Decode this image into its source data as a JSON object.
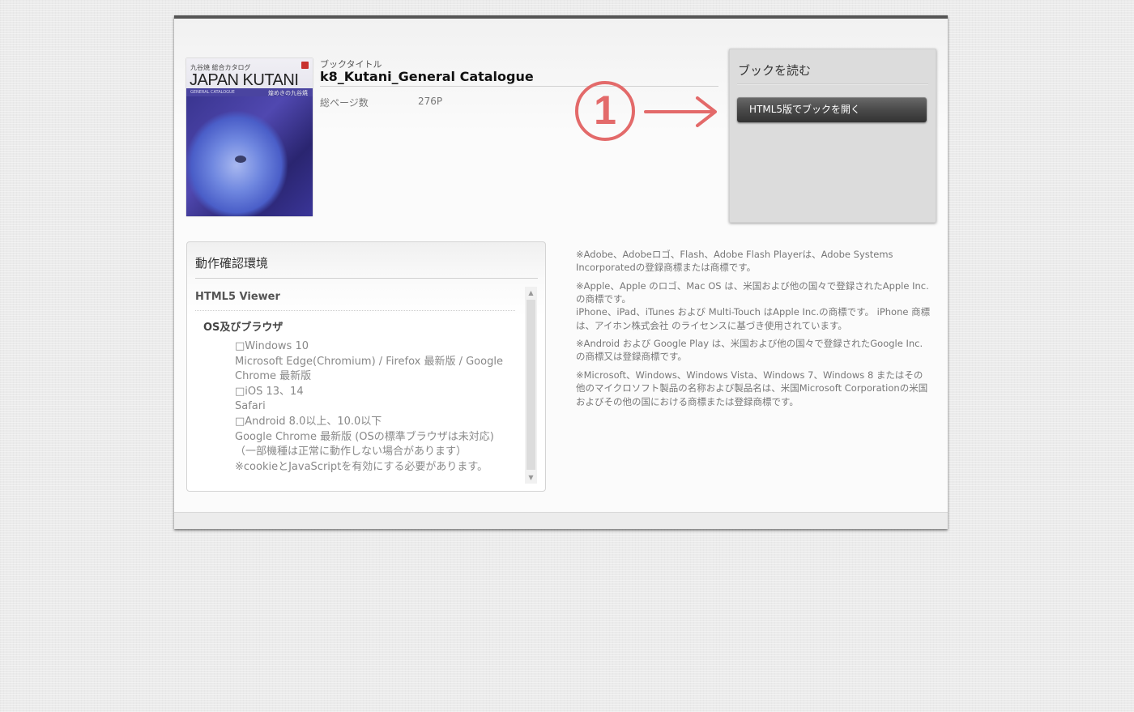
{
  "book": {
    "cover": {
      "subtitle": "九谷焼 総合カタログ",
      "title": "JAPAN KUTANI",
      "strip_en": "GENERAL CATALOGUE",
      "strip_jp": "煌めきの九谷焼"
    },
    "title_label": "ブックタイトル",
    "title": "k8_Kutani_General Catalogue",
    "pages_label": "総ページ数",
    "pages_value": "276P"
  },
  "annotation": {
    "number": "1",
    "color": "#e36a6a"
  },
  "read_box": {
    "title": "ブックを読む",
    "open_button": "HTML5版でブックを開く"
  },
  "environment": {
    "title": "動作確認環境",
    "viewer_heading": "HTML5 Viewer",
    "os_heading": "OS及びブラウザ",
    "lines": [
      "□Windows 10",
      "Microsoft Edge(Chromium) / Firefox 最新版 / Google",
      "Chrome 最新版",
      "□iOS 13、14",
      "Safari",
      "□Android 8.0以上、10.0以下",
      "Google Chrome 最新版 (OSの標準ブラウザは未対応)",
      "（一部機種は正常に動作しない場合があります）",
      "※cookieとJavaScriptを有効にする必要があります。"
    ],
    "scroll_up": "▲",
    "scroll_down": "▼"
  },
  "trademarks": [
    [
      "※Adobe、Adobeロゴ、Flash、Adobe Flash Playerは、Adobe Systems",
      "Incorporatedの登録商標または商標です。"
    ],
    [
      "※Apple、Apple のロゴ、Mac OS は、米国および他の国々で登録されたApple Inc.",
      "の商標です。",
      "iPhone、iPad、iTunes および Multi-Touch はApple Inc.の商標です。 iPhone 商標",
      "は、アイホン株式会社 のライセンスに基づき使用されています。"
    ],
    [
      "※Android および Google Play は、米国および他の国々で登録されたGoogle Inc.",
      "の商標又は登録商標です。"
    ],
    [
      "※Microsoft、Windows、Windows Vista、Windows 7、Windows 8 またはその",
      "他のマイクロソフト製品の名称および製品名は、米国Microsoft Corporationの米国",
      "およびその他の国における商標または登録商標です。"
    ]
  ]
}
